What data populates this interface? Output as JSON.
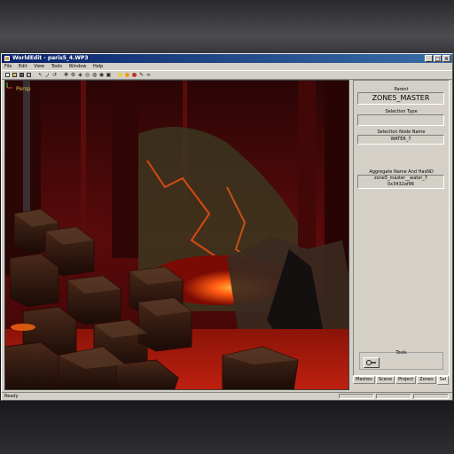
{
  "window": {
    "title": "WorldEdit - paris5_4.WP3"
  },
  "titlebar_buttons": [
    "_",
    "□",
    "×"
  ],
  "menu": [
    "File",
    "Edit",
    "View",
    "Tools",
    "Window",
    "Help"
  ],
  "viewport": {
    "label": "Persp"
  },
  "panel": {
    "parent_label": "Parent",
    "parent_value": "ZONE5_MASTER",
    "selection_type_label": "Selection Type",
    "selection_type_value": "",
    "selection_node_label": "Selection Node Name",
    "selection_node_value": "WATER_7",
    "aggregate_label": "Aggregate Name And HasND",
    "aggregate_value_1": "zone5_master__water_7",
    "aggregate_value_2": "0x3432af96",
    "tools_label": "Tools"
  },
  "tabs": [
    "Meshes",
    "Scene",
    "Project",
    "Zones",
    "Sel"
  ],
  "active_tab": "Sel",
  "status": {
    "text": "Ready"
  },
  "colors": {
    "titlebar": "#0a246a",
    "lava": "#ff5a10",
    "dark_red": "#4a0808",
    "persp_label": "#d8c44a"
  }
}
